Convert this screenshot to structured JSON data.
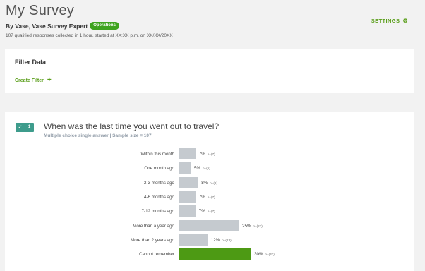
{
  "header": {
    "title": "My Survey",
    "byline": "By Vase, Vase Survey Expert",
    "badge": "Operations",
    "meta": "107 qualified responses collected in 1 hour, started at XX:XX p.m. on XX/XX/20XX",
    "settings_label": "SETTINGS",
    "settings_icon": "gear-icon"
  },
  "filter": {
    "title": "Filter Data",
    "create_label": "Create Filter",
    "create_icon": "plus-icon"
  },
  "question": {
    "number": "1",
    "title": "When was the last time you went out to travel?",
    "subtitle": "Multiple choice single answer | Sample size = 107",
    "toggle_color": "#3e9c8c",
    "highlight_color": "#4d9a14",
    "bar_color": "#c5cacf"
  },
  "chart_data": {
    "type": "bar",
    "orientation": "horizontal",
    "categories": [
      "Within this month",
      "One month ago",
      "2-3 months ago",
      "4-6 months ago",
      "7-12 months ago",
      "More than a year ago",
      "More than 2 years ago",
      "Cannot remember"
    ],
    "values": [
      7,
      5,
      8,
      7,
      7,
      25,
      12,
      30
    ],
    "value_labels": [
      "7%",
      "5%",
      "8%",
      "7%",
      "7%",
      "25%",
      "12%",
      "30%"
    ],
    "count_labels": [
      "n=(7)",
      "n=(5)",
      "n=(9)",
      "n=(7)",
      "n=(7)",
      "n=(27)",
      "n=(13)",
      "n=(32)"
    ],
    "highlight_index": 7,
    "unit": "%"
  }
}
